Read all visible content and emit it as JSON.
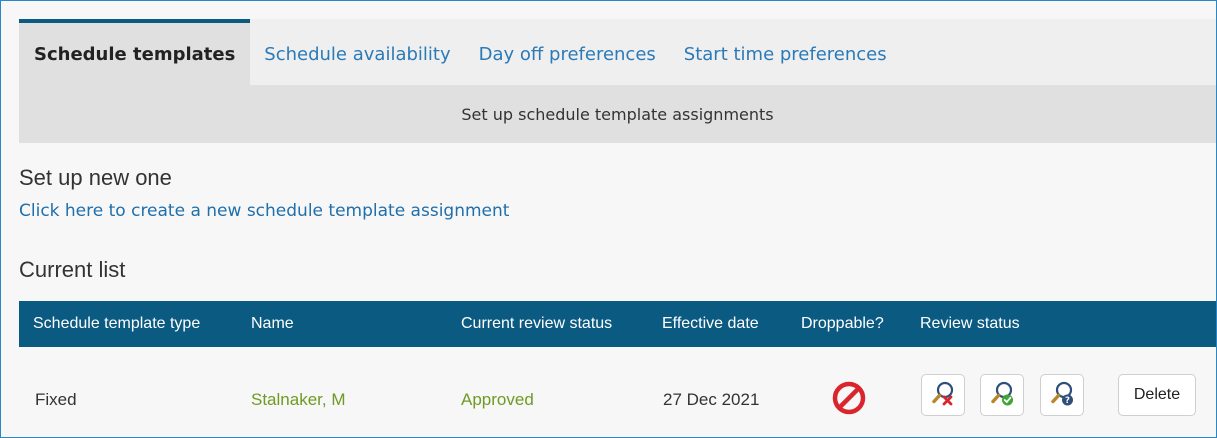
{
  "tabs": [
    {
      "label": "Schedule templates",
      "active": true
    },
    {
      "label": "Schedule availability"
    },
    {
      "label": "Day off preferences"
    },
    {
      "label": "Start time preferences"
    }
  ],
  "subheader": "Set up schedule template assignments",
  "setup": {
    "title": "Set up new one",
    "link": "Click here to create a new schedule template assignment"
  },
  "current_list": {
    "title": "Current list",
    "columns": [
      "Schedule template type",
      "Name",
      "Current review status",
      "Effective date",
      "Droppable?",
      "Review status"
    ],
    "rows": [
      {
        "type": "Fixed",
        "name": "Stalnaker, M",
        "status": "Approved",
        "effective_date": "27 Dec 2021",
        "droppable_icon": "prohibited-icon",
        "review_icons": [
          "review-reject-icon",
          "review-approve-icon",
          "review-pending-icon"
        ],
        "delete_label": "Delete"
      }
    ]
  },
  "colors": {
    "header_bg": "#0b5a82",
    "link": "#1f6fab",
    "name_green": "#6f9a24",
    "prohibited_red": "#d9262c"
  }
}
